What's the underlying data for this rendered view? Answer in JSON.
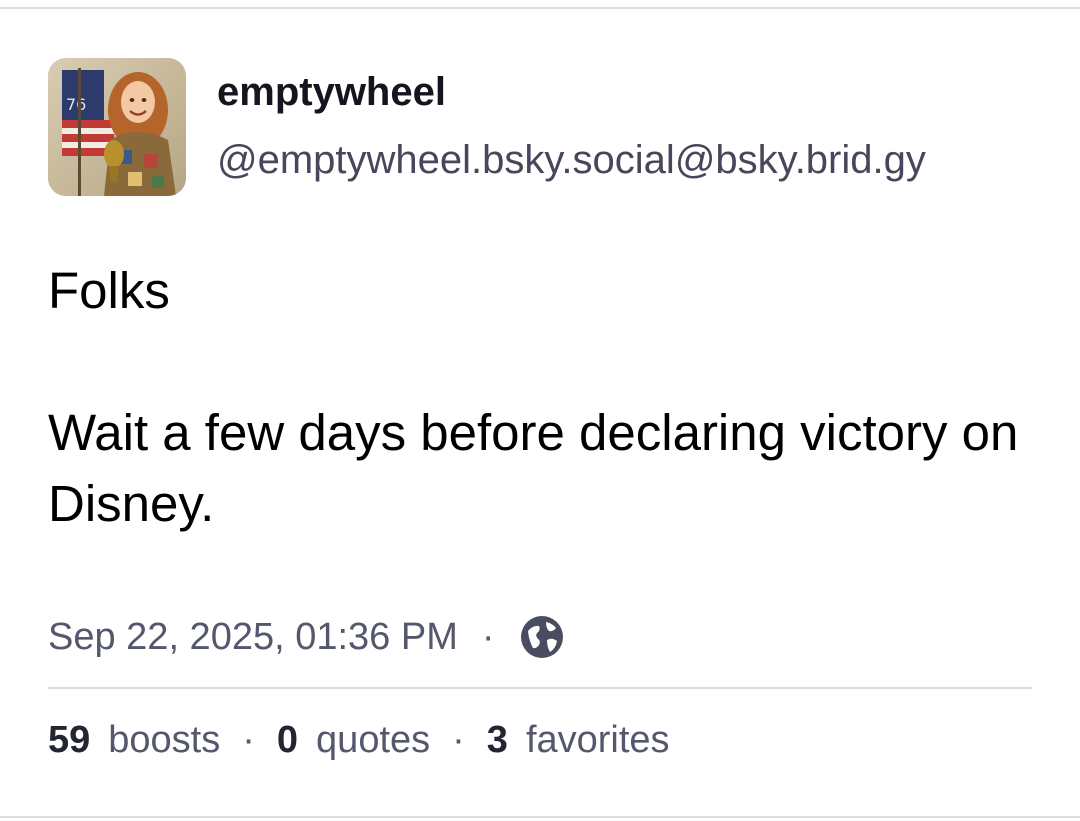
{
  "author": {
    "display_name": "emptywheel",
    "handle": "@emptywheel.bsky.social@bsky.brid.gy",
    "avatar_icon": "profile-photo"
  },
  "post": {
    "paragraphs": [
      "Folks",
      "Wait a few days before declaring victory on Disney."
    ]
  },
  "meta": {
    "timestamp": "Sep 22, 2025, 01:36 PM",
    "separator": "·",
    "visibility_icon": "globe-icon"
  },
  "stats": {
    "boosts_count": "59",
    "boosts_label": "boosts",
    "quotes_count": "0",
    "quotes_label": "quotes",
    "favorites_count": "3",
    "favorites_label": "favorites",
    "separator": "·"
  },
  "colors": {
    "text_primary": "#000000",
    "text_secondary": "#55576d",
    "divider": "#d9d9e1"
  }
}
